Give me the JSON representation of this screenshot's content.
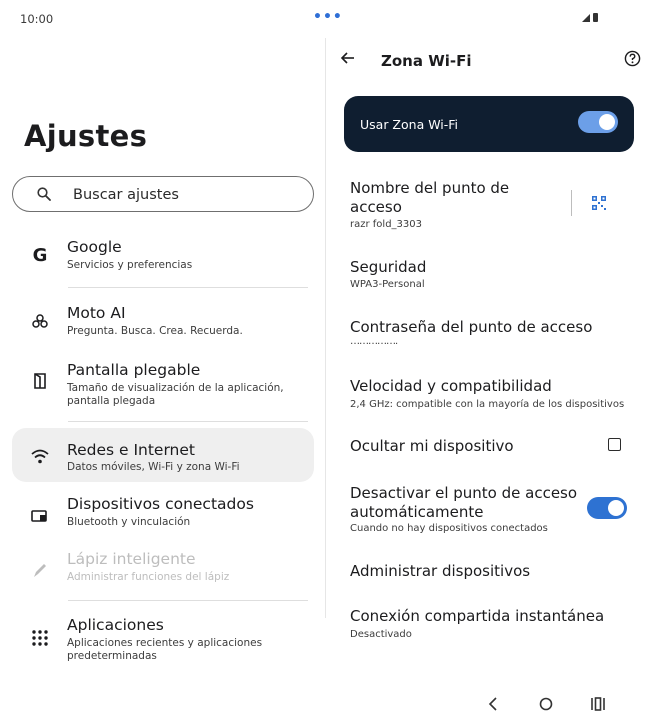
{
  "status": {
    "time": "10:00",
    "dots": "•••"
  },
  "left": {
    "title": "Ajustes",
    "search_placeholder": "Buscar ajustes",
    "items": [
      {
        "title": "Google",
        "subtitle": "Servicios y preferencias",
        "icon": "google-icon"
      },
      {
        "title": "Moto AI",
        "subtitle": "Pregunta. Busca. Crea. Recuerda.",
        "icon": "moto-ai-icon"
      },
      {
        "title": "Pantalla plegable",
        "subtitle": "Tamaño de visualización de la aplicación, pantalla plegada",
        "icon": "foldable-icon"
      },
      {
        "title": "Redes e Internet",
        "subtitle": "Datos móviles, Wi-Fi y zona Wi-Fi",
        "icon": "wifi-icon"
      },
      {
        "title": "Dispositivos conectados",
        "subtitle": "Bluetooth y vinculación",
        "icon": "connected-devices-icon"
      },
      {
        "title": "Lápiz inteligente",
        "subtitle": "Administrar funciones del lápiz",
        "icon": "pen-icon"
      },
      {
        "title": "Aplicaciones",
        "subtitle": "Aplicaciones recientes y aplicaciones predeterminadas",
        "icon": "apps-grid-icon"
      }
    ]
  },
  "right": {
    "title": "Zona Wi-Fi",
    "main_switch_label": "Usar Zona Wi-Fi",
    "main_switch_on": true,
    "hotspot_name_title": "Nombre del punto de acceso",
    "hotspot_name_value": "razr fold_3303",
    "security_title": "Seguridad",
    "security_value": "WPA3-Personal",
    "password_title": "Contraseña del punto de acceso",
    "password_value": "…………….",
    "speed_title": "Velocidad y compatibilidad",
    "speed_value": "2,4 GHz: compatible con la mayoría de los dispositivos",
    "hide_device_title": "Ocultar mi dispositivo",
    "hide_device_checked": false,
    "auto_off_title": "Desactivar el punto de acceso automáticamente",
    "auto_off_sub": "Cuando no hay dispositivos conectados",
    "auto_off_on": true,
    "manage_devices_title": "Administrar dispositivos",
    "instant_share_title": "Conexión compartida instantánea",
    "instant_share_value": "Desactivado"
  },
  "colors": {
    "accent": "#2e72d2",
    "dark_bar": "#0f1e30",
    "active_bg": "#efefef"
  }
}
